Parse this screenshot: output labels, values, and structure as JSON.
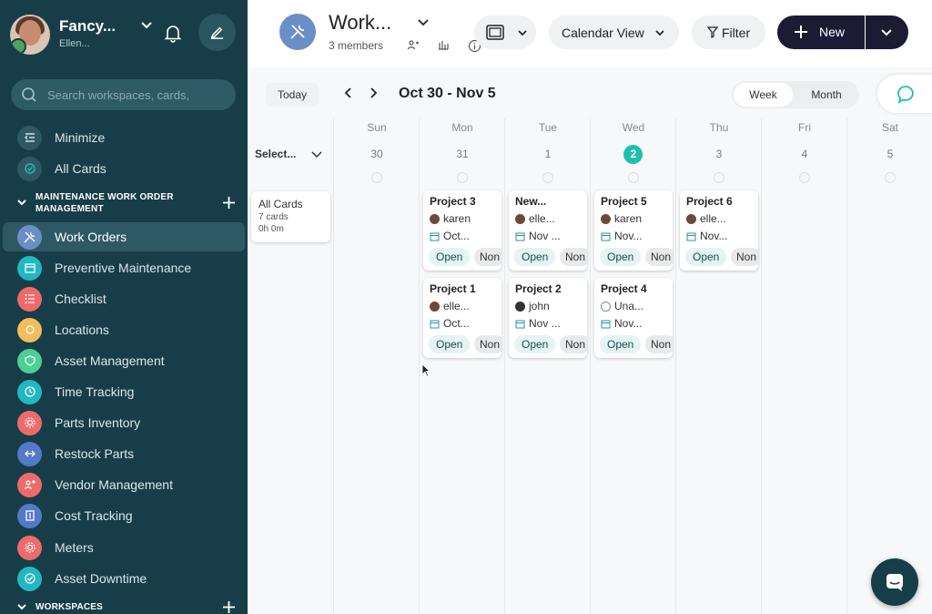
{
  "workspace": {
    "name": "Fancy...",
    "user": "Ellen..."
  },
  "search": {
    "placeholder": "Search workspaces, cards,"
  },
  "sidebar": {
    "top_items": [
      {
        "label": "Minimize",
        "icon": "collapse-icon"
      },
      {
        "label": "All Cards",
        "icon": "cards-icon"
      }
    ],
    "section_title": "MAINTENANCE WORK ORDER MANAGEMENT",
    "items": [
      {
        "label": "Work Orders",
        "icon": "tools-icon",
        "color": "#6a8fc7"
      },
      {
        "label": "Preventive Maintenance",
        "icon": "calendar-icon",
        "color": "#21b8c2"
      },
      {
        "label": "Checklist",
        "icon": "checklist-icon",
        "color": "#ef6b6b"
      },
      {
        "label": "Locations",
        "icon": "location-icon",
        "color": "#f2bd5b"
      },
      {
        "label": "Asset Management",
        "icon": "shield-icon",
        "color": "#4ccf97"
      },
      {
        "label": "Time Tracking",
        "icon": "clock-icon",
        "color": "#21b8c2"
      },
      {
        "label": "Parts Inventory",
        "icon": "gear-icon",
        "color": "#ef6b6b"
      },
      {
        "label": "Restock Parts",
        "icon": "restock-icon",
        "color": "#5479c8"
      },
      {
        "label": "Vendor Management",
        "icon": "vendor-icon",
        "color": "#ef6b6b"
      },
      {
        "label": "Cost Tracking",
        "icon": "cost-icon",
        "color": "#5479c8"
      },
      {
        "label": "Meters",
        "icon": "meter-icon",
        "color": "#ef6b6b"
      },
      {
        "label": "Asset Downtime",
        "icon": "downtime-icon",
        "color": "#21b8c2"
      }
    ],
    "section2_title": "WORKSPACES"
  },
  "header": {
    "title": "Work...",
    "members": "3 members",
    "view_label": "Calendar View",
    "filter_label": "Filter",
    "new_label": "New"
  },
  "calendar": {
    "today_label": "Today",
    "range": "Oct 30 - Nov 5",
    "week_label": "Week",
    "month_label": "Month",
    "select_label": "Select...",
    "days": [
      {
        "name": "Sun",
        "num": "30"
      },
      {
        "name": "Mon",
        "num": "31"
      },
      {
        "name": "Tue",
        "num": "1"
      },
      {
        "name": "Wed",
        "num": "2"
      },
      {
        "name": "Thu",
        "num": "3"
      },
      {
        "name": "Fri",
        "num": "4"
      },
      {
        "name": "Sat",
        "num": "5"
      }
    ],
    "summary": {
      "title": "All Cards",
      "count": "7 cards",
      "time": "0h 0m"
    }
  },
  "cards": [
    {
      "title": "Project 3",
      "assignee": "karen",
      "date": "Oct...",
      "status": "Open",
      "priority": "Non"
    },
    {
      "title": "New...",
      "assignee": "elle...",
      "date": "Nov ...",
      "status": "Open",
      "priority": "Non"
    },
    {
      "title": "Project 5",
      "assignee": "karen",
      "date": "Nov...",
      "status": "Open",
      "priority": "Non"
    },
    {
      "title": "Project 6",
      "assignee": "elle...",
      "date": "Nov...",
      "status": "Open",
      "priority": "Non"
    },
    {
      "title": "Project 1",
      "assignee": "elle...",
      "date": "Oct...",
      "status": "Open",
      "priority": "Non"
    },
    {
      "title": "Project 2",
      "assignee": "john",
      "date": "Nov ...",
      "status": "Open",
      "priority": "Non"
    },
    {
      "title": "Project 4",
      "assignee": "Una...",
      "date": "Nov...",
      "status": "Open",
      "priority": "Non"
    }
  ],
  "colors": {
    "sidebar_bg": "#173e48",
    "accent_today": "#1fbfae",
    "new_button": "#1d1b33"
  }
}
